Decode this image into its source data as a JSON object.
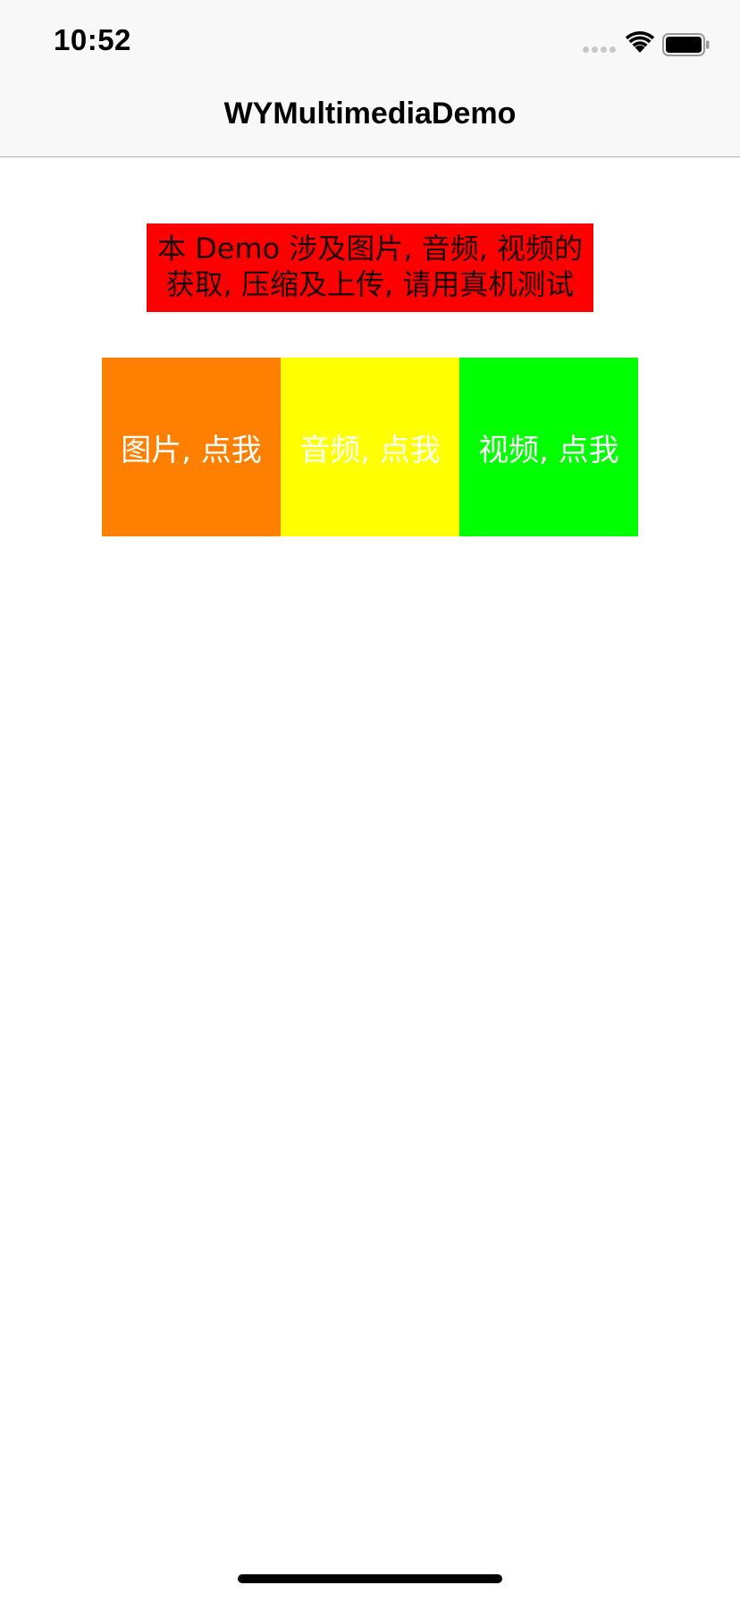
{
  "status_bar": {
    "time": "10:52",
    "icons": [
      "signal-dots-icon",
      "wifi-icon",
      "battery-icon"
    ]
  },
  "nav": {
    "title": "WYMultimediaDemo"
  },
  "notice": {
    "line1": "本 Demo 涉及图片, 音频, 视频的",
    "line2": "获取, 压缩及上传, 请用真机测试",
    "background": "#ff0000"
  },
  "buttons": [
    {
      "label": "图片, 点我",
      "color": "#ff8000"
    },
    {
      "label": "音频, 点我",
      "color": "#ffff00"
    },
    {
      "label": "视频, 点我",
      "color": "#00ff00"
    }
  ]
}
